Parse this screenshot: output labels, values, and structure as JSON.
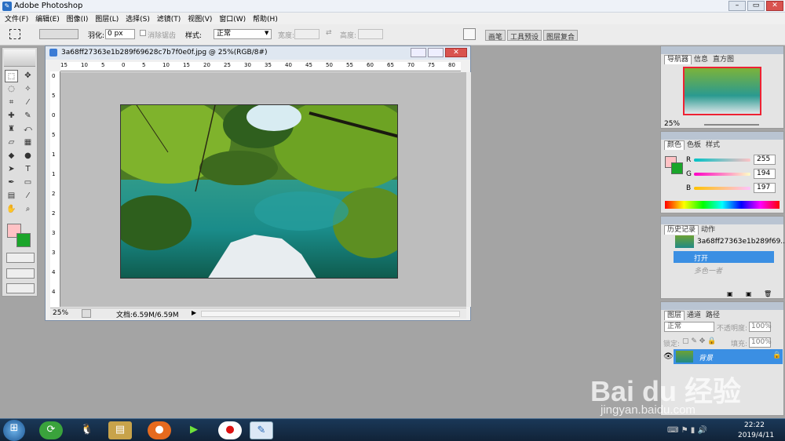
{
  "app": {
    "title": "Adobe Photoshop"
  },
  "window_controls": {
    "minimize": "–",
    "restore": "▭",
    "close": "✕"
  },
  "menu": [
    "文件(F)",
    "编辑(E)",
    "图像(I)",
    "图层(L)",
    "选择(S)",
    "滤镜(T)",
    "视图(V)",
    "窗口(W)",
    "帮助(H)"
  ],
  "options": {
    "feather_label": "羽化:",
    "feather_value": "0 px",
    "antialias_label": "消除锯齿",
    "style_label": "样式:",
    "style_value": "正常",
    "width_label": "宽度:",
    "height_label": "高度:",
    "palette_tabs": [
      "画笔",
      "工具预设",
      "图层复合"
    ]
  },
  "document": {
    "title": "3a68ff27363e1b289f69628c7b7f0e0f.jpg @ 25%(RGB/8#)",
    "zoom": "25%",
    "doc_size": "文档:6.59M/6.59M",
    "ruler_top": [
      "15",
      "10",
      "5",
      "0",
      "5",
      "10",
      "15",
      "20",
      "25",
      "30",
      "35",
      "40",
      "45",
      "50",
      "55",
      "60",
      "65",
      "70",
      "75",
      "80"
    ],
    "ruler_left": [
      "0",
      "5",
      "0",
      "5",
      "1",
      "1",
      "2",
      "2",
      "3",
      "3",
      "4",
      "4"
    ]
  },
  "navigator": {
    "tabs": [
      "导航器",
      "信息",
      "直方图"
    ],
    "zoom": "25%"
  },
  "color": {
    "tabs": [
      "颜色",
      "色板",
      "样式"
    ],
    "r_label": "R",
    "g_label": "G",
    "b_label": "B",
    "r": 255,
    "g": 194,
    "b": 197,
    "foreground": "#ffc2c5",
    "background": "#1aa52a"
  },
  "history": {
    "tabs": [
      "历史记录",
      "动作"
    ],
    "snapshot": "3a68ff27363e1b289f69...",
    "items": [
      {
        "label": "打开"
      },
      {
        "label": "多色一者"
      }
    ]
  },
  "layers": {
    "tabs": [
      "图层",
      "通道",
      "路径"
    ],
    "blend": "正常",
    "opacity_label": "不透明度:",
    "opacity": "100%",
    "lock_label": "锁定:",
    "fill_label": "填充:",
    "fill": "100%",
    "layer_name": "背景"
  },
  "taskbar": {
    "time": "22:22",
    "date": "2019/4/11"
  },
  "watermark": {
    "brand": "Bai du 经验",
    "url": "jingyan.baidu.com"
  }
}
